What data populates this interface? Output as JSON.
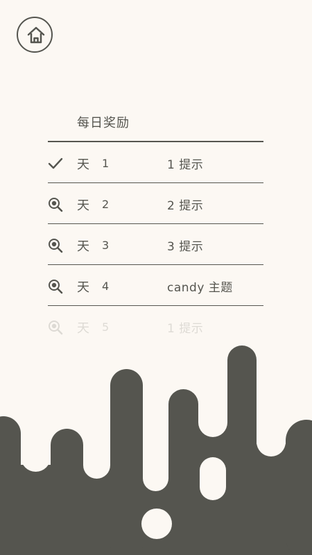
{
  "header": {
    "home_icon": "home-icon"
  },
  "title": "每日奖励",
  "colors": {
    "background": "#fcf8f3",
    "foreground": "#55554f"
  },
  "rewards": [
    {
      "day_word": "天",
      "day": "1",
      "reward": "1 提示",
      "icon": "check-icon",
      "status": "claimed"
    },
    {
      "day_word": "天",
      "day": "2",
      "reward": "2 提示",
      "icon": "magnifier-eye-icon",
      "status": "locked"
    },
    {
      "day_word": "天",
      "day": "3",
      "reward": "3 提示",
      "icon": "magnifier-eye-icon",
      "status": "locked"
    },
    {
      "day_word": "天",
      "day": "4",
      "reward": "candy 主题",
      "icon": "magnifier-eye-icon",
      "status": "locked"
    },
    {
      "day_word": "天",
      "day": "5",
      "reward": "1 提示",
      "icon": "magnifier-eye-icon",
      "status": "faded"
    }
  ]
}
